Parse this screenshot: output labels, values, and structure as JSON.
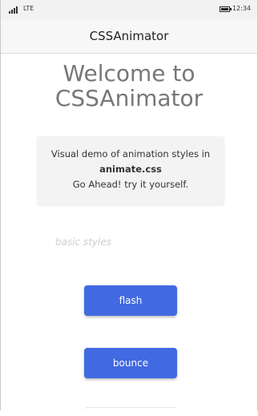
{
  "status_bar": {
    "network": "LTE",
    "time": "12:34"
  },
  "app_bar": {
    "title": "CSSAnimator"
  },
  "welcome": {
    "line1": "Welcome to",
    "line2": "CSSAnimator"
  },
  "info_card": {
    "line1": "Visual demo of animation styles in",
    "line2": "animate.css",
    "line3": "Go Ahead! try it yourself."
  },
  "section": {
    "label": "basic styles"
  },
  "buttons": [
    {
      "label": "flash"
    },
    {
      "label": "bounce"
    }
  ],
  "colors": {
    "button_bg": "#4169e1",
    "button_text": "#ffffff",
    "welcome_text": "#777777",
    "section_label": "#cfcfcf"
  }
}
